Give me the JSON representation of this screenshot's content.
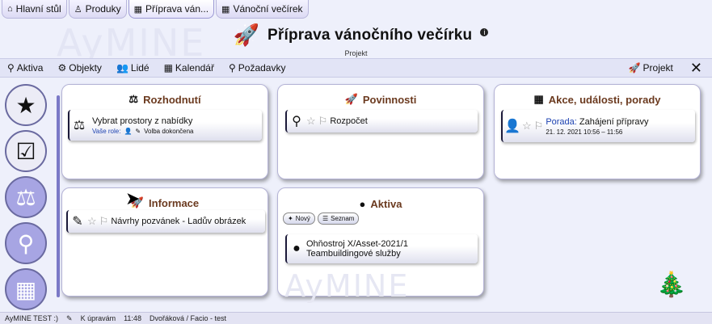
{
  "tabs": [
    {
      "icon": "home-icon",
      "glyph": "⌂",
      "label": "Hlavní stůl"
    },
    {
      "icon": "products-icon",
      "glyph": "♙",
      "label": "Produky"
    },
    {
      "icon": "project-icon",
      "glyph": "▦",
      "label": "Příprava ván..."
    },
    {
      "icon": "project-icon",
      "glyph": "▦",
      "label": "Vánoční večírek"
    }
  ],
  "watermark_top": "AyMINE",
  "header": {
    "title": "Příprava vánočního večírku",
    "subtitle": "Projekt"
  },
  "menu": {
    "items": [
      "Aktiva",
      "Objekty",
      "Lidé",
      "Kalendář",
      "Požadavky"
    ],
    "project_label": "Projekt"
  },
  "cards": {
    "rozhodnuti": {
      "title": "Rozhodnutí",
      "item_title": "Vybrat prostory z nabídky",
      "role_label": "Vaše role:",
      "status": "Volba dokončena"
    },
    "povinnosti": {
      "title": "Povinnosti",
      "item_title": "Rozpočet"
    },
    "akce": {
      "title": "Akce, události, porady",
      "item_type": "Porada:",
      "item_title": "Zahájení přípravy",
      "item_time": "21. 12. 2021 10:56 – 11:56"
    },
    "informace": {
      "title": "Informace",
      "item_title": "Návrhy pozvánek - Ladův obrázek"
    },
    "aktiva": {
      "title": "Aktiva",
      "btn_new": "Nový",
      "btn_list": "Seznam",
      "item_line1": "Ohňostroj X/Asset-2021/1",
      "item_line2": "Teambuildingové služby"
    }
  },
  "watermark_bottom": "AyMINE",
  "status": {
    "app": "AyMINE TEST :)",
    "mode": "K úpravám",
    "time": "11:48",
    "user": "Dvořáková / Facio - test"
  },
  "colors": {
    "accent": "#a7a5e3",
    "card_title": "#6b3a1f",
    "link": "#1a3fb0"
  }
}
